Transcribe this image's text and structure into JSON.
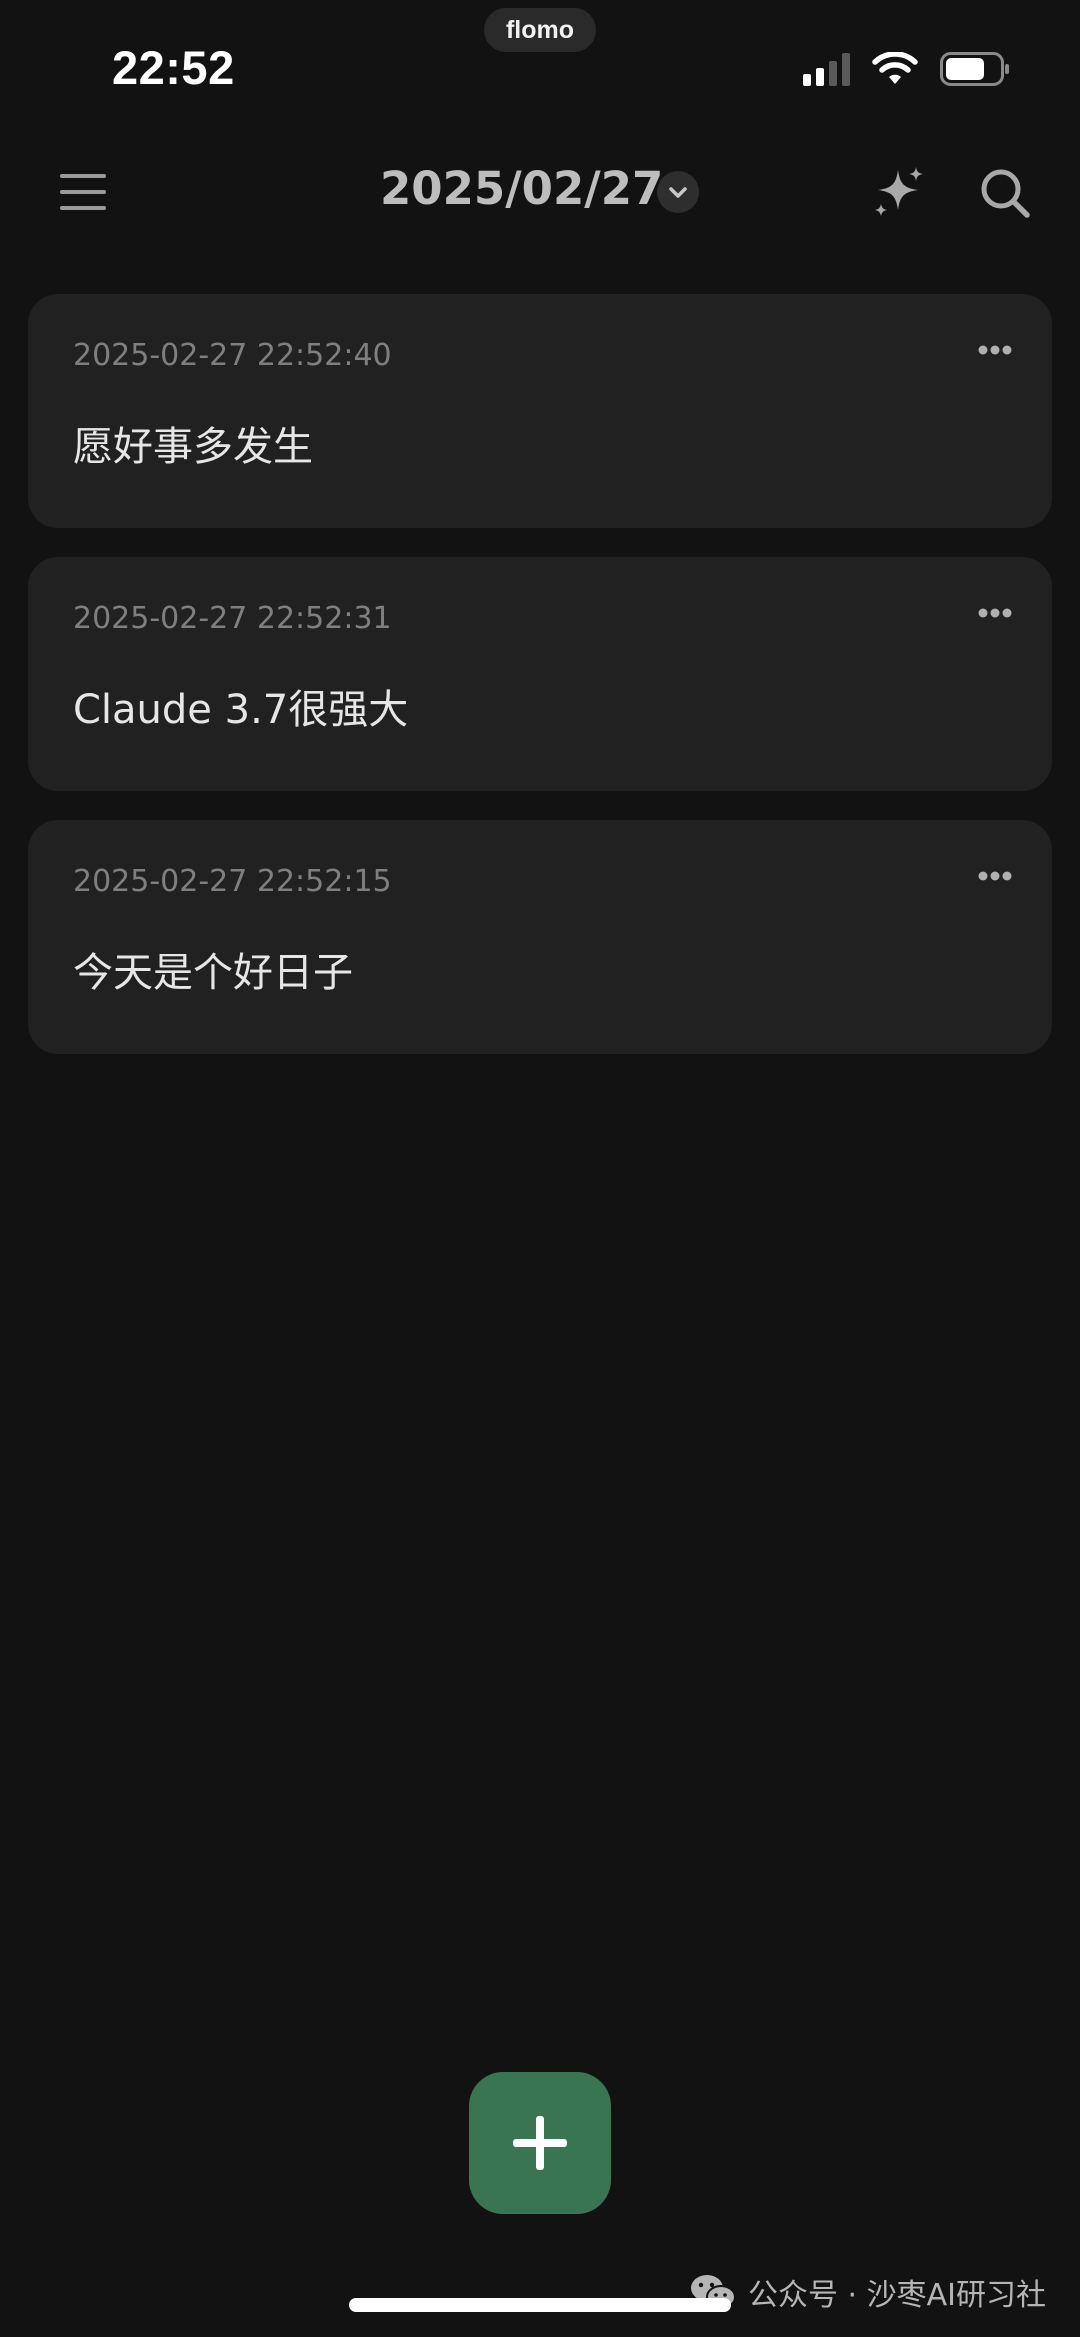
{
  "app_pill": "flomo",
  "status_bar": {
    "time": "22:52",
    "icons": [
      "signal-icon",
      "wifi-icon",
      "battery-icon"
    ]
  },
  "header": {
    "date": "2025/02/27",
    "icons": [
      "menu-icon",
      "chevron-down-icon",
      "sparkle-icon",
      "search-icon"
    ]
  },
  "memos": [
    {
      "timestamp": "2025-02-27 22:52:40",
      "content": "愿好事多发生"
    },
    {
      "timestamp": "2025-02-27 22:52:31",
      "content": "Claude 3.7很强大"
    },
    {
      "timestamp": "2025-02-27 22:52:15",
      "content": "今天是个好日子"
    }
  ],
  "fab": {
    "icon": "plus-icon"
  },
  "watermark": {
    "text": "公众号 · 沙枣AI研习社",
    "icon": "wechat-icon"
  },
  "colors": {
    "background": "#121212",
    "card": "#212121",
    "accent_green": "#3a7552",
    "timestamp_gray": "#7f7f7f"
  }
}
